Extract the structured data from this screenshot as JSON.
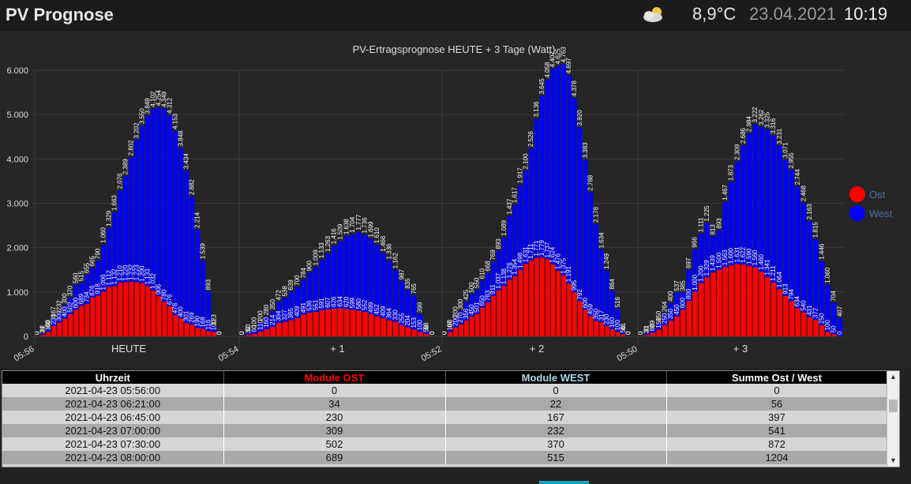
{
  "header": {
    "title": "PV Prognose",
    "temperature": "8,9°C",
    "date": "23.04.2021",
    "time": "10:19",
    "weather_icon": "partly-cloudy-icon"
  },
  "colors": {
    "ost": "#ff0000",
    "west": "#0000ff",
    "background": "#262626",
    "grid": "#3a3a3a"
  },
  "chart_data": {
    "type": "bar",
    "stacked": true,
    "title": "PV-Ertragsprognose HEUTE + 3 Tage (Watt)",
    "ylim": [
      0,
      6000
    ],
    "yticks": [
      "0",
      "1.000",
      "2.000",
      "3.000",
      "4.000",
      "5.000",
      "6.000"
    ],
    "ytick_values": [
      0,
      1000,
      2000,
      3000,
      4000,
      5000,
      6000
    ],
    "grid": true,
    "legend_position": "right",
    "x_time_labels": [
      "05:56",
      "05:54",
      "05:52",
      "05:50"
    ],
    "day_labels": [
      "HEUTE",
      "+ 1",
      "+ 2",
      "+ 3"
    ],
    "days": [
      {
        "ost": [
          0,
          34,
          100,
          230,
          309,
          400,
          502,
          600,
          689,
          734,
          876,
          918,
          1006,
          1112,
          1132,
          1210,
          1220,
          1232,
          1223,
          1200,
          1133,
          1032,
          906,
          780,
          676,
          478,
          400,
          301,
          269,
          190,
          168,
          116,
          100,
          0
        ],
        "west": [
          0,
          22,
          60,
          167,
          232,
          300,
          370,
          560,
          515,
          655,
          665,
          790,
          1060,
          1329,
          1663,
          2076,
          2389,
          2802,
          3202,
          3550,
          3848,
          4102,
          4254,
          4349,
          4312,
          4153,
          3848,
          3434,
          2882,
          2214,
          1539,
          893,
          123,
          0
        ],
        "sum": [
          0,
          56,
          160,
          397,
          541,
          700,
          872,
          1160,
          1204,
          1389,
          1541,
          1708,
          2066,
          2441,
          2795,
          3286,
          3609,
          4034,
          4425,
          4750,
          4981,
          5134,
          5160,
          5129,
          4988,
          4631,
          4248,
          3735,
          3151,
          2404,
          1707,
          1009,
          223,
          0
        ]
      },
      {
        "ost": [
          0,
          30,
          60,
          110,
          160,
          214,
          304,
          327,
          365,
          409,
          491,
          536,
          551,
          591,
          607,
          626,
          634,
          620,
          599,
          580,
          552,
          499,
          452,
          409,
          364,
          330,
          255,
          204,
          153,
          100,
          58,
          0
        ],
        "west": [
          0,
          50,
          100,
          200,
          280,
          350,
          472,
          538,
          639,
          700,
          784,
          900,
          1009,
          1133,
          1263,
          1416,
          1509,
          1638,
          1704,
          1777,
          1736,
          1699,
          1610,
          1466,
          1336,
          1162,
          987,
          835,
          765,
          399,
          58,
          0
        ],
        "sum": [
          0,
          80,
          160,
          310,
          440,
          564,
          776,
          865,
          1004,
          1109,
          1275,
          1436,
          1560,
          1724,
          1870,
          2042,
          2143,
          2258,
          2303,
          2357,
          2288,
          2198,
          2062,
          1875,
          1700,
          1492,
          1242,
          1039,
          918,
          499,
          116,
          0
        ]
      },
      {
        "ost": [
          0,
          100,
          200,
          270,
          356,
          450,
          501,
          650,
          763,
          911,
          1037,
          1138,
          1276,
          1354,
          1498,
          1631,
          1711,
          1771,
          1779,
          1737,
          1624,
          1476,
          1375,
          1191,
          995,
          792,
          600,
          459,
          350,
          317,
          230,
          160,
          100,
          50,
          0
        ],
        "west": [
          0,
          67,
          200,
          300,
          425,
          500,
          550,
          610,
          668,
          769,
          893,
          1089,
          1437,
          1617,
          1917,
          2100,
          2526,
          3136,
          3645,
          4058,
          4407,
          4625,
          4763,
          4697,
          4378,
          3920,
          3383,
          2788,
          2178,
          1634,
          1249,
          864,
          516,
          61,
          0
        ],
        "sum": [
          0,
          167,
          400,
          570,
          781,
          950,
          1051,
          1260,
          1431,
          1680,
          1930,
          2227,
          2713,
          2971,
          3415,
          3731,
          4237,
          4907,
          5424,
          5795,
          6031,
          6101,
          6138,
          5888,
          5373,
          4712,
          3983,
          3247,
          2528,
          1951,
          1479,
          1024,
          616,
          111,
          0
        ]
      },
      {
        "ost": [
          0,
          30,
          80,
          150,
          250,
          350,
          450,
          600,
          800,
          1000,
          1200,
          1329,
          1439,
          1500,
          1563,
          1600,
          1631,
          1622,
          1590,
          1560,
          1460,
          1341,
          1211,
          1064,
          913,
          794,
          634,
          540,
          431,
          372,
          250,
          100,
          50,
          0
        ],
        "west": [
          0,
          31,
          89,
          150,
          264,
          400,
          537,
          385,
          697,
          966,
          1111,
          1225,
          813,
          893,
          1467,
          1873,
          2309,
          2686,
          2984,
          3222,
          3262,
          3325,
          3316,
          3231,
          3071,
          2955,
          2744,
          2468,
          2163,
          1815,
          1446,
          1060,
          704,
          407,
          0
        ],
        "sum": [
          0,
          61,
          169,
          300,
          514,
          750,
          987,
          985,
          1497,
          1966,
          2311,
          2554,
          2252,
          2393,
          3030,
          3473,
          3940,
          4308,
          4574,
          4782,
          4722,
          4666,
          4527,
          4295,
          3984,
          3749,
          3378,
          3008,
          2594,
          2187,
          1696,
          1160,
          754,
          407,
          0
        ]
      }
    ],
    "series": [
      {
        "name": "Ost",
        "color": "#ff0000"
      },
      {
        "name": "West",
        "color": "#0000ff"
      }
    ]
  },
  "table": {
    "headers": [
      "Uhrzeit",
      "Module OST",
      "Module WEST",
      "Summe Ost / West"
    ],
    "header_colors": [
      "#ffffff",
      "#ff0000",
      "#add8e6",
      "#ffffff"
    ],
    "rows": [
      [
        "2021-04-23 05:56:00",
        "0",
        "0",
        "0"
      ],
      [
        "2021-04-23 06:21:00",
        "34",
        "22",
        "56"
      ],
      [
        "2021-04-23 06:45:00",
        "230",
        "167",
        "397"
      ],
      [
        "2021-04-23 07:00:00",
        "309",
        "232",
        "541"
      ],
      [
        "2021-04-23 07:30:00",
        "502",
        "370",
        "872"
      ],
      [
        "2021-04-23 08:00:00",
        "689",
        "515",
        "1204"
      ]
    ]
  }
}
